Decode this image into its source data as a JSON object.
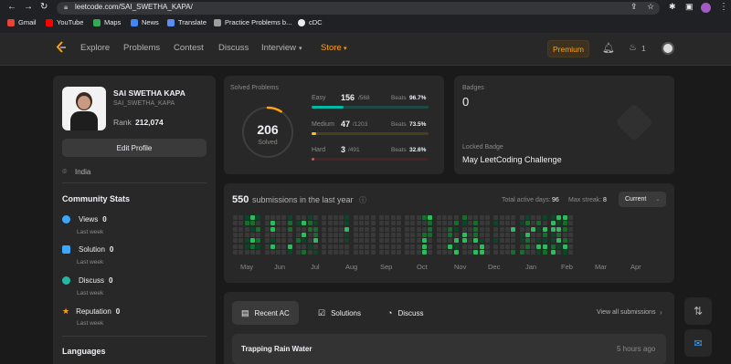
{
  "browser": {
    "url": "leetcode.com/SAI_SWETHA_KAPA/",
    "bookmarks": [
      "Gmail",
      "YouTube",
      "Maps",
      "News",
      "Translate",
      "Practice Problems b...",
      "cDC"
    ]
  },
  "topnav": {
    "links": [
      "Explore",
      "Problems",
      "Contest",
      "Discuss",
      "Interview",
      "Store"
    ],
    "premium_label": "Premium",
    "streak_count": "1"
  },
  "profile": {
    "name": "SAI SWETHA KAPA",
    "username": "SAI_SWETHA_KAPA",
    "rank_label": "Rank",
    "rank_value": "212,074",
    "edit_label": "Edit Profile",
    "location": "India"
  },
  "community": {
    "title": "Community Stats",
    "stats": [
      {
        "label": "Views",
        "value": "0",
        "sub": "Last week",
        "icon": "eye-icon",
        "color": "#2cbb5d"
      },
      {
        "label": "Solution",
        "value": "0",
        "sub": "Last week",
        "icon": "solution-icon",
        "color": "#3ba7ff"
      },
      {
        "label": "Discuss",
        "value": "0",
        "sub": "Last week",
        "icon": "discuss-icon",
        "color": "#26b6a4"
      },
      {
        "label": "Reputation",
        "value": "0",
        "sub": "Last week",
        "icon": "star-icon",
        "color": "#ffa116"
      }
    ],
    "languages_title": "Languages"
  },
  "solved": {
    "title": "Solved Problems",
    "total": "206",
    "total_label": "Solved",
    "rows": [
      {
        "label": "Easy",
        "solved": "156",
        "total": "/568",
        "beats_label": "Beats",
        "beats": "96.7%",
        "color": "#00b8a3",
        "fraction": 0.275
      },
      {
        "label": "Medium",
        "solved": "47",
        "total": "/1203",
        "beats_label": "Beats",
        "beats": "73.5%",
        "color": "#ffc01e",
        "fraction": 0.039
      },
      {
        "label": "Hard",
        "solved": "3",
        "total": "/491",
        "beats_label": "Beats",
        "beats": "32.6%",
        "color": "#ef4743",
        "fraction": 0.006
      }
    ]
  },
  "badges": {
    "title": "Badges",
    "count": "0",
    "locked_label": "Locked Badge",
    "locked_name": "May LeetCoding Challenge"
  },
  "submissions": {
    "count": "550",
    "label": "submissions in the last year",
    "active_label": "Total active days:",
    "active_value": "96",
    "streak_label": "Max streak:",
    "streak_value": "8",
    "dropdown": "Current",
    "months": [
      "May",
      "Jun",
      "Jul",
      "Aug",
      "Sep",
      "Oct",
      "Nov",
      "Dec",
      "Jan",
      "Feb",
      "Mar",
      "Apr"
    ]
  },
  "recent": {
    "tabs": [
      "Recent AC",
      "Solutions",
      "Discuss"
    ],
    "view_all": "View all submissions",
    "items": [
      {
        "title": "Trapping Rain Water",
        "time": "5 hours ago"
      }
    ]
  },
  "colors": {
    "accent": "#ffa116",
    "green_dark": "#0e4429",
    "green_mid": "#196c2e",
    "green_bright": "#2cbb5d",
    "cell_empty": "#393939"
  }
}
